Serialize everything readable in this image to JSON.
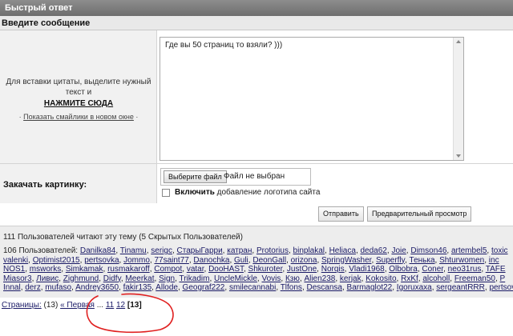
{
  "window": {
    "title": "Быстрый ответ"
  },
  "message_section": {
    "title": "Введите сообщение"
  },
  "quote_hint": {
    "line1": "Для вставки цитаты, выделите нужный",
    "line2": "текст и",
    "action": "НАЖМИТЕ СЮДА",
    "smiles_prefix": "·",
    "smiles_link": "Показать смайлики в новом окне",
    "smiles_suffix": "·"
  },
  "message": {
    "text": "Где вы 50 страниц то взяли? )))"
  },
  "upload": {
    "label": "Закачать картинку:",
    "button": "Выберите файл",
    "status": "Файл не выбран",
    "logo_bold": "Включить",
    "logo_rest": "добавление логотипа сайта"
  },
  "actions": {
    "send": "Отправить",
    "preview": "Предварительный просмотр"
  },
  "readers": {
    "summary": "111 Пользователей читают эту тему (5 Скрытых Пользователей)",
    "prefix": "106 Пользователей:",
    "rows": [
      [
        "Danilka84",
        "Tinamu",
        "serigc",
        "СтарыГарри",
        "катран",
        "Protorius",
        "binplakal",
        "Heliaca",
        "deda62",
        "Joie",
        "Dimson46",
        "artembel5",
        "toxic"
      ],
      [
        "valenki",
        "Optimist2015",
        "pertsovka",
        "Jommo",
        "77saint77",
        "Danochka",
        "Guli",
        "DeonGall",
        "orizona",
        "SpringWasher",
        "Superfly",
        "Тенька",
        "Shturwomen",
        "inc"
      ],
      [
        "NOS1",
        "msworks",
        "Simkamak",
        "rusmakaroff",
        "Compot",
        "vatar",
        "DooHAST",
        "Shkuroter",
        "JustOne",
        "Norqis",
        "Vladi1968",
        "Olbobra",
        "Coner",
        "neo31rus",
        "TAFE"
      ],
      [
        "Miasor3",
        "Ливис",
        "Zighmund",
        "Didfy",
        "Meerkat",
        "Sign",
        "Trikadim",
        "UncleMickle",
        "Vovis",
        "Кзю",
        "Alien238",
        "kerjak",
        "Kokosito",
        "RxKf",
        "alcoholl",
        "Freeman50",
        "P"
      ],
      [
        "Innal",
        "derz",
        "mufaso",
        "Andrey3650",
        "fakir135",
        "Allode",
        "Geograf222",
        "smilecannabi",
        "Tlfons",
        "Descansa",
        "Barmaglot22",
        "Igoruxaxa",
        "sergeantRRR",
        "pertsovka"
      ]
    ]
  },
  "pagination": {
    "label": "Страницы:",
    "count": "(13)",
    "first": "« Первая",
    "ellipsis": "...",
    "pages": [
      "11",
      "12"
    ],
    "current": "[13]"
  },
  "colors": {
    "annotation": "#e02020",
    "link": "#1a1a66",
    "titlebar": "#7a7a7a"
  }
}
